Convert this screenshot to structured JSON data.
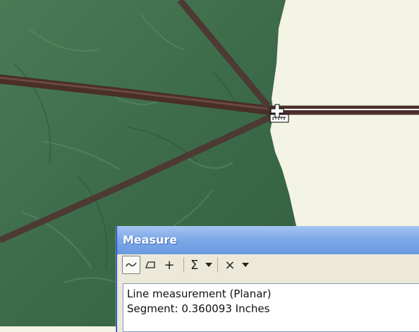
{
  "measure_window": {
    "title": "Measure",
    "toolbar": {
      "tools": [
        {
          "name": "measure-line",
          "icon": "line-measure-icon",
          "active": true
        },
        {
          "name": "measure-area",
          "icon": "area-measure-icon",
          "active": false
        },
        {
          "name": "measure-feature",
          "icon": "feature-measure-icon",
          "active": false
        },
        {
          "name": "show-total",
          "icon": "sigma-icon",
          "active": false
        },
        {
          "name": "clear",
          "icon": "clear-icon",
          "active": false
        }
      ]
    },
    "result": {
      "line1": "Line measurement (Planar)",
      "line2": "Segment: 0.360093 Inches"
    }
  },
  "colors": {
    "title_bar": "#7ea9e8",
    "window_bg": "#ece9d8",
    "map_leaf": "#3e6e4a",
    "map_background": "#f4f4e4"
  }
}
